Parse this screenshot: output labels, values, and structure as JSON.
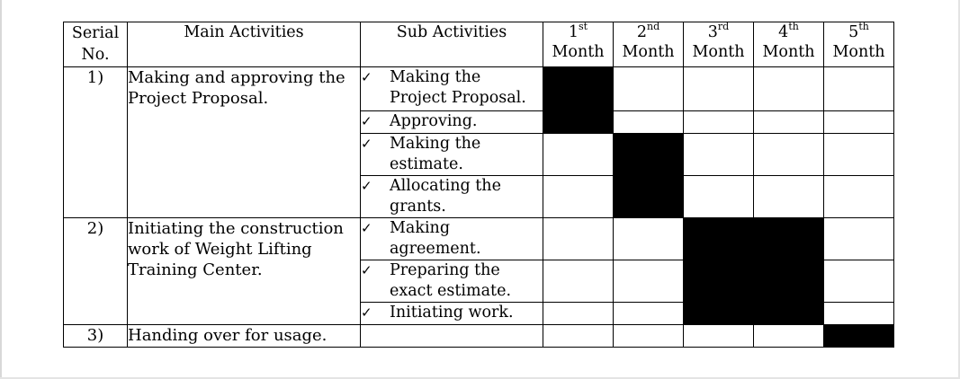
{
  "headers": {
    "serial_line1": "Serial",
    "serial_line2": "No.",
    "main": "Main Activities",
    "sub": "Sub Activities",
    "months": [
      {
        "num": "1",
        "sup": "st",
        "label": "Month"
      },
      {
        "num": "2",
        "sup": "nd",
        "label": "Month"
      },
      {
        "num": "3",
        "sup": "rd",
        "label": "Month"
      },
      {
        "num": "4",
        "sup": "th",
        "label": "Month"
      },
      {
        "num": "5",
        "sup": "th",
        "label": "Month"
      }
    ]
  },
  "check_mark": "✓",
  "groups": [
    {
      "serial": "1)",
      "main_line1": "Making and approving the",
      "main_line2": "Project Proposal.",
      "subs": [
        {
          "line1": "Making the",
          "line2": "Project Proposal.",
          "months": [
            true,
            false,
            false,
            false,
            false
          ]
        },
        {
          "line1": "Approving.",
          "line2": "",
          "months": [
            true,
            false,
            false,
            false,
            false
          ]
        },
        {
          "line1": "Making the",
          "line2": "estimate.",
          "months": [
            false,
            true,
            false,
            false,
            false
          ]
        },
        {
          "line1": "Allocating the",
          "line2": "grants.",
          "months": [
            false,
            true,
            false,
            false,
            false
          ]
        }
      ]
    },
    {
      "serial": "2)",
      "main_line1": "Initiating the construction",
      "main_line2": "work of Weight Lifting",
      "main_line3": "Training Center.",
      "subs": [
        {
          "line1": "Making",
          "line2": "agreement.",
          "months": [
            false,
            false,
            true,
            true,
            false
          ]
        },
        {
          "line1": "Preparing the",
          "line2": "exact estimate.",
          "months": [
            false,
            false,
            true,
            true,
            false
          ]
        },
        {
          "line1": "Initiating work.",
          "line2": "",
          "months": [
            false,
            false,
            true,
            true,
            false
          ]
        }
      ]
    },
    {
      "serial": "3)",
      "main_line1": "Handing over for usage.",
      "months": [
        false,
        false,
        false,
        false,
        true
      ]
    }
  ]
}
